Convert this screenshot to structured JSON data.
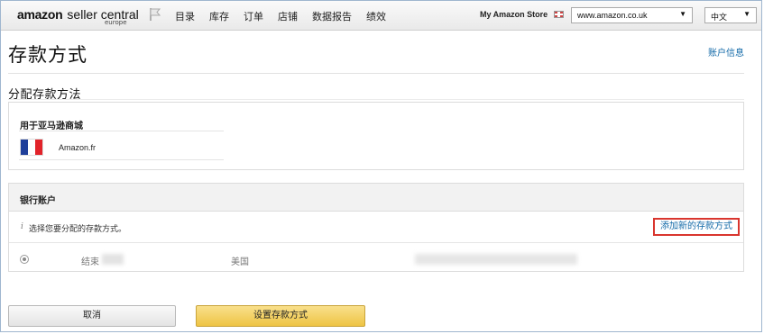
{
  "header": {
    "logo_brand": "amazon",
    "logo_product": "seller central",
    "logo_region": "europe",
    "nav": [
      "目录",
      "库存",
      "订单",
      "店铺",
      "数据报告",
      "绩效"
    ],
    "my_store": "My Amazon Store",
    "domain_select": "www.amazon.co.uk",
    "language_select": "中文"
  },
  "page": {
    "title": "存款方式",
    "account_info_link": "账户信息",
    "section_title": "分配存款方法"
  },
  "marketplace": {
    "label": "用于亚马逊商城",
    "name": "Amazon.fr",
    "flag_colors": [
      "#1f3f9a",
      "#ffffff",
      "#e2232a"
    ]
  },
  "bank": {
    "title": "银行账户",
    "info_icon": "i",
    "info_text": "选择您要分配的存款方式。",
    "add_link": "添加新的存款方式",
    "account_end_label": "结束",
    "account_country": "美国"
  },
  "buttons": {
    "cancel": "取消",
    "set": "设置存款方式"
  },
  "colors": {
    "link": "#136aa8",
    "highlight_box": "#d9352e",
    "primary_button": "#eec444"
  }
}
